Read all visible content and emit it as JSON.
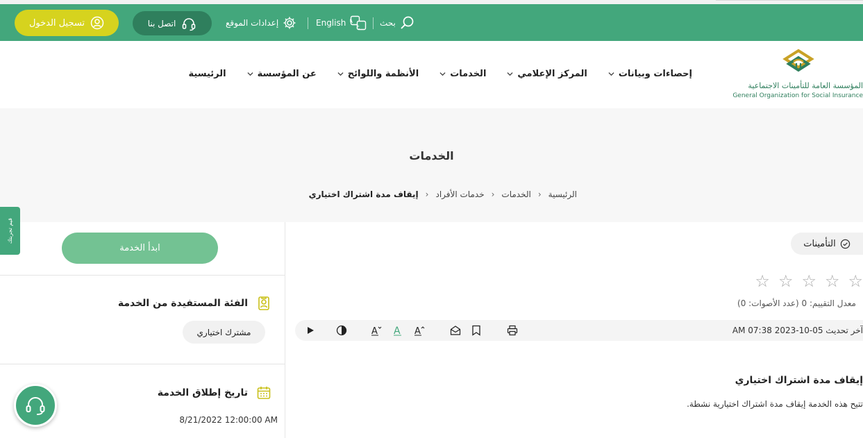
{
  "topbar": {
    "login_label": "تسجيل الدخول",
    "contact_label": "اتصل بنا",
    "settings_label": "إعدادات الموقع",
    "language_label": "English",
    "search_label": "بحث"
  },
  "logo": {
    "ar": "المؤسسة العامة للتأمينات الاجتماعية",
    "en": "General Organization for Social Insurance"
  },
  "nav": {
    "items": [
      {
        "label": "الرئيسية",
        "has_dropdown": false
      },
      {
        "label": "عن المؤسسة",
        "has_dropdown": true
      },
      {
        "label": "الأنظمة واللوائح",
        "has_dropdown": true
      },
      {
        "label": "الخدمات",
        "has_dropdown": true
      },
      {
        "label": "المركز الإعلامي",
        "has_dropdown": true
      },
      {
        "label": "إحصاءات وبيانات",
        "has_dropdown": true
      }
    ]
  },
  "hero": {
    "title": "الخدمات",
    "breadcrumb": [
      "الرئيسية",
      "الخدمات",
      "خدمات الأفراد",
      "إيقاف مدة اشتراك اختياري"
    ]
  },
  "feedback_tab": "قيم تجربتك",
  "sidebar": {
    "start_label": "ابدأ الخدمة",
    "beneficiary_heading": "الفئة المستفيدة من الخدمة",
    "beneficiary_value": "مشترك اختياري",
    "launch_heading": "تاريخ إطلاق الخدمة",
    "launch_value": "8/21/2022 12:00:00 AM"
  },
  "main": {
    "tag": "التأمينات",
    "rating": {
      "value": 0,
      "max": 5,
      "text": "معدل التقييم: 0 (عدد الأصوات: 0)"
    },
    "updated": "آخر تحديث 05-10-2023 07:38 AM",
    "service_title": "إيقاف مدة اشتراك اختياري",
    "service_desc": "تتيح هذه الخدمة إيقاف مدة اشتراك اختيارية نشطة."
  },
  "colors": {
    "brand_green": "#43a77c",
    "dark_green": "#2f7f5d",
    "login_yellow": "#d6d31e",
    "start_button": "#73c293",
    "icon_gold": "#c9c01a"
  },
  "icons": {
    "login": "user-circle-icon",
    "contact": "headset-icon",
    "settings": "gear-icon",
    "language": "translate-icon",
    "search": "search-icon"
  }
}
